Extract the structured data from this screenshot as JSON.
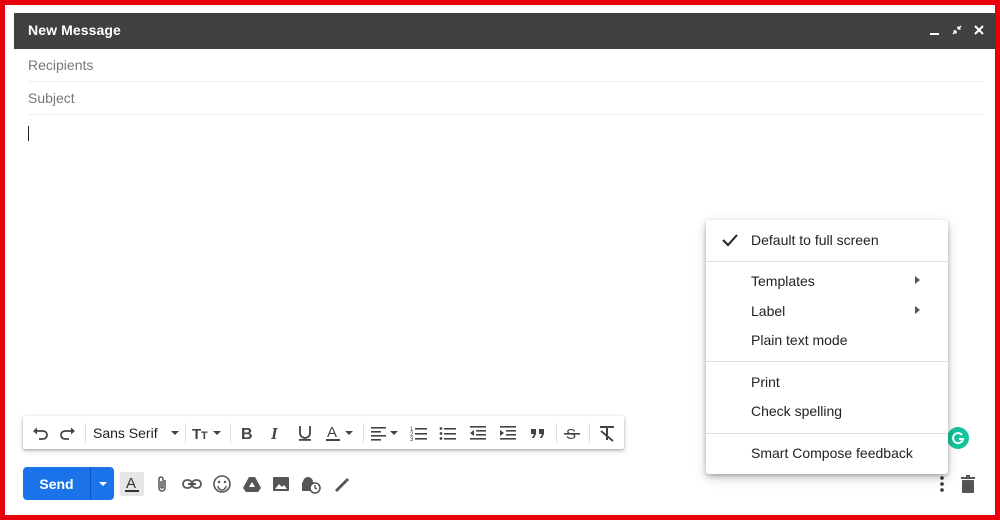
{
  "window": {
    "title": "New Message",
    "controls": [
      "minimize-icon",
      "exit-fullscreen-icon",
      "close-icon"
    ]
  },
  "fields": {
    "recipients_placeholder": "Recipients",
    "subject_placeholder": "Subject"
  },
  "formatting": {
    "font_name": "Sans Serif",
    "buttons": [
      "undo-icon",
      "redo-icon",
      "font-size-icon",
      "bold-icon",
      "italic-icon",
      "underline-icon",
      "text-color-icon",
      "align-icon",
      "numbered-list-icon",
      "bulleted-list-icon",
      "indent-less-icon",
      "indent-more-icon",
      "quote-icon",
      "strikethrough-icon",
      "remove-formatting-icon"
    ]
  },
  "bottom": {
    "send_label": "Send",
    "icons": [
      "formatting-options-icon",
      "attach-icon",
      "link-icon",
      "emoji-icon",
      "drive-icon",
      "photo-icon",
      "confidential-mode-icon",
      "signature-icon",
      "more-options-icon",
      "trash-icon"
    ]
  },
  "menu": {
    "checked_item": "Default to full screen",
    "items": [
      {
        "label": "Templates",
        "submenu": true
      },
      {
        "label": "Label",
        "submenu": true
      },
      {
        "label": "Plain text mode",
        "submenu": false
      }
    ],
    "items2": [
      {
        "label": "Print"
      },
      {
        "label": "Check spelling"
      }
    ],
    "last_item": "Smart Compose feedback"
  },
  "colors": {
    "frame_border": "#e8000b",
    "titlebar": "#404040",
    "send_button": "#1a73e8",
    "grammarly": "#15c39a"
  }
}
